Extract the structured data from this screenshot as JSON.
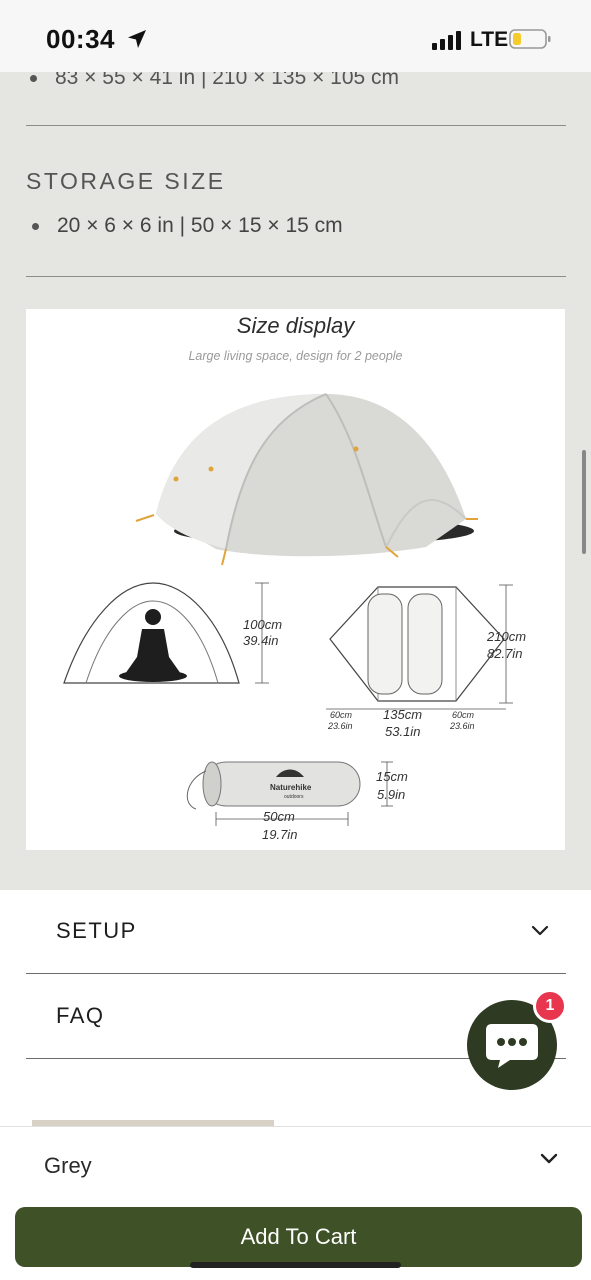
{
  "status_bar": {
    "time": "00:34",
    "network": "LTE",
    "icons": [
      "location-arrow-icon",
      "signal-bars-icon",
      "battery-low-icon"
    ]
  },
  "specs": {
    "packed_size_partial": "83 × 55 × 41 in | 210 × 135 × 105 cm",
    "storage_title": "STORAGE SIZE",
    "storage_value": "20 × 6 × 6 in | 50 × 15 × 15 cm"
  },
  "size_display": {
    "title": "Size display",
    "subtitle": "Large living space, design for 2 people",
    "height_cm": "100cm",
    "height_in": "39.4in",
    "length_cm": "210cm",
    "length_in": "82.7in",
    "vestibule_cm": "60cm",
    "vestibule_in": "23.6in",
    "width_cm": "135cm",
    "width_in": "53.1in",
    "bag_diameter_cm": "15cm",
    "bag_diameter_in": "5.9in",
    "bag_length_cm": "50cm",
    "bag_length_in": "19.7in",
    "bag_brand": "Naturehike",
    "bag_brand_sub": "outdoors"
  },
  "accordions": [
    {
      "label": "SETUP"
    },
    {
      "label": "FAQ"
    }
  ],
  "chat": {
    "badge_count": "1"
  },
  "sticky_bar": {
    "variant": "Grey",
    "add_to_cart": "Add To Cart"
  },
  "colors": {
    "band_bg": "#e5e6e1",
    "button_green": "#3f5127",
    "chat_green": "#2e3a22",
    "badge_red": "#e8364f"
  }
}
